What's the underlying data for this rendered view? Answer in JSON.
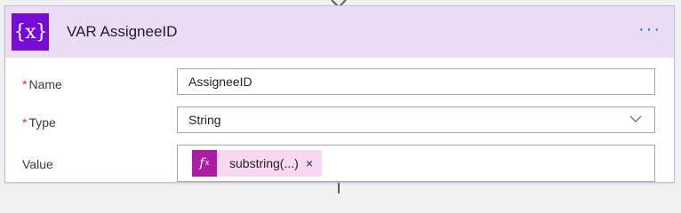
{
  "card": {
    "title": "VAR AssigneeID",
    "header_icon": "{x}",
    "more_label": "···",
    "accent_color": "#770bd6"
  },
  "fields": {
    "name": {
      "required_marker": "*",
      "label": "Name",
      "value": "AssigneeID"
    },
    "type": {
      "required_marker": "*",
      "label": "Type",
      "value": "String",
      "icon": "chevron-down-icon"
    },
    "value": {
      "label": "Value",
      "token": {
        "icon_text": "f",
        "icon_sub": "x",
        "label": "substring(...)",
        "remove_label": "×",
        "color": "#ab1ea3"
      }
    }
  }
}
